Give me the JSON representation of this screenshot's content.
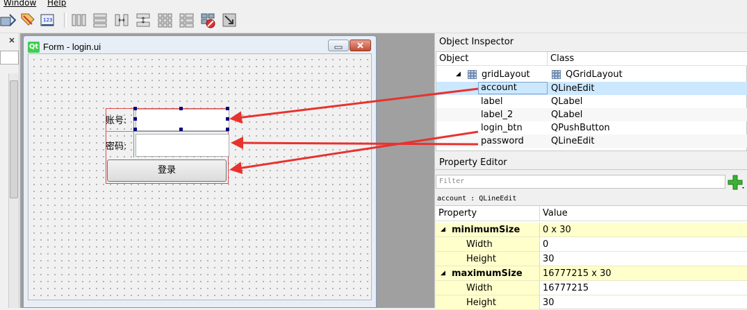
{
  "menu": {
    "window": "Window",
    "help": "Help"
  },
  "toolbar": {
    "icons": [
      "edit-signals-icon",
      "edit-buddies-icon",
      "edit-tab-order-icon",
      "layout-horizontal-icon",
      "layout-vertical-icon",
      "layout-horizontal-splitter-icon",
      "layout-vertical-splitter-icon",
      "layout-grid-icon",
      "layout-form-icon",
      "break-layout-icon",
      "adjust-size-icon"
    ]
  },
  "form": {
    "title": "Form - login.ui",
    "logo": "Qt",
    "account_label": "账号:",
    "password_label": "密码:",
    "login_button": "登录"
  },
  "object_inspector": {
    "title": "Object Inspector",
    "col_object": "Object",
    "col_class": "Class",
    "rows": [
      {
        "object": "gridLayout",
        "class": "QGridLayout"
      },
      {
        "object": "account",
        "class": "QLineEdit"
      },
      {
        "object": "label",
        "class": "QLabel"
      },
      {
        "object": "label_2",
        "class": "QLabel"
      },
      {
        "object": "login_btn",
        "class": "QPushButton"
      },
      {
        "object": "password",
        "class": "QLineEdit"
      }
    ]
  },
  "property_editor": {
    "title": "Property Editor",
    "filter_placeholder": "Filter",
    "caption": "account : QLineEdit",
    "col_property": "Property",
    "col_value": "Value",
    "rows": [
      {
        "property": "minimumSize",
        "value": "0 x 30"
      },
      {
        "property": "Width",
        "value": "0"
      },
      {
        "property": "Height",
        "value": "30"
      },
      {
        "property": "maximumSize",
        "value": "16777215 x 30"
      },
      {
        "property": "Width",
        "value": "16777215"
      },
      {
        "property": "Height",
        "value": "30"
      }
    ]
  },
  "colors": {
    "selection": "#cce8ff",
    "property_group": "#ffffcc",
    "arrow": "#e8322e",
    "layout_border": "#e04848"
  }
}
